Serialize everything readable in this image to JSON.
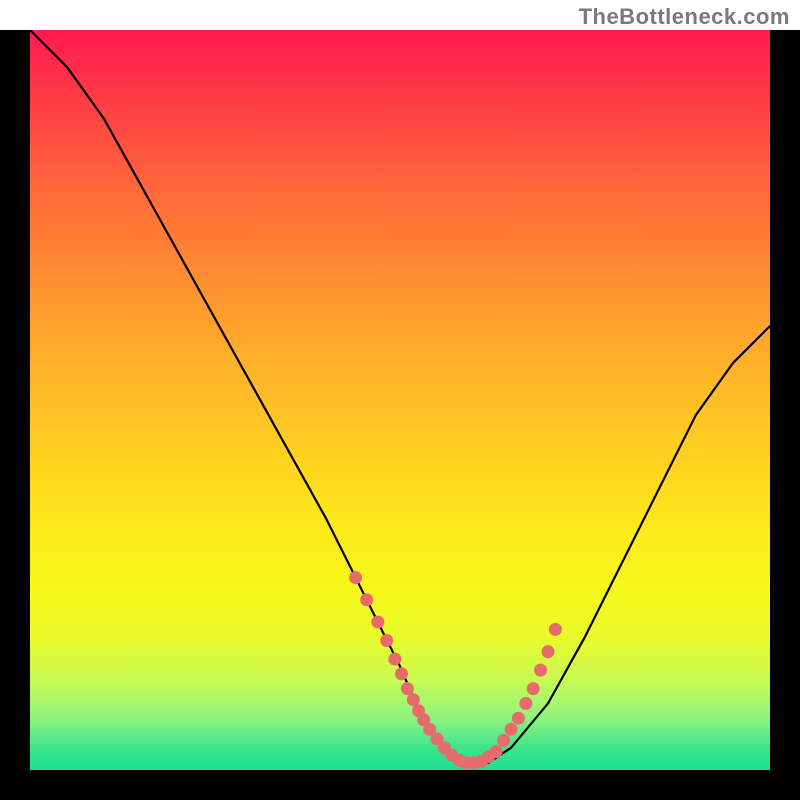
{
  "watermark": "TheBottleneck.com",
  "chart_data": {
    "type": "line",
    "title": "",
    "xlabel": "",
    "ylabel": "",
    "xlim": [
      0,
      100
    ],
    "ylim": [
      0,
      100
    ],
    "series": [
      {
        "name": "bottleneck-curve",
        "x": [
          0,
          5,
          10,
          15,
          20,
          25,
          30,
          35,
          40,
          45,
          50,
          53,
          56,
          59,
          62,
          65,
          70,
          75,
          80,
          85,
          90,
          95,
          100
        ],
        "y": [
          100,
          95,
          88,
          79,
          70,
          61,
          52,
          43,
          34,
          24,
          14,
          7,
          3,
          1,
          1,
          3,
          9,
          18,
          28,
          38,
          48,
          55,
          60
        ]
      },
      {
        "name": "highlight-dots-left",
        "x": [
          44,
          45.5,
          47,
          48.2,
          49.3,
          50.2,
          51,
          51.8,
          52.5,
          53.2,
          54,
          55,
          56
        ],
        "y": [
          26,
          23,
          20,
          17.5,
          15,
          13,
          11,
          9.5,
          8,
          6.8,
          5.5,
          4.2,
          3
        ]
      },
      {
        "name": "highlight-dots-bottom",
        "x": [
          57,
          58,
          59,
          60,
          61,
          62,
          63
        ],
        "y": [
          2,
          1.3,
          1,
          1,
          1.2,
          1.8,
          2.5
        ]
      },
      {
        "name": "highlight-dots-right",
        "x": [
          64,
          65,
          66,
          67,
          68,
          69,
          70,
          71
        ],
        "y": [
          4,
          5.5,
          7,
          9,
          11,
          13.5,
          16,
          19
        ]
      }
    ],
    "colors": {
      "curve": "#000000",
      "dots": "#e86b6b"
    }
  }
}
